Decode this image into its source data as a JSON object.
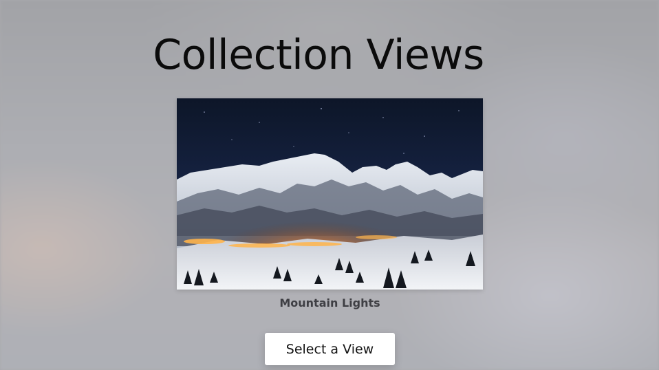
{
  "header": {
    "title": "Collection Views"
  },
  "collection": {
    "items": [
      {
        "title": "Mountain Lights"
      }
    ]
  },
  "actions": {
    "select_view_label": "Select a View"
  },
  "colors": {
    "background": "#a9a9ae",
    "button_bg": "#ffffff",
    "title_text": "#0b0b0b",
    "caption_text": "#3f3f44"
  }
}
